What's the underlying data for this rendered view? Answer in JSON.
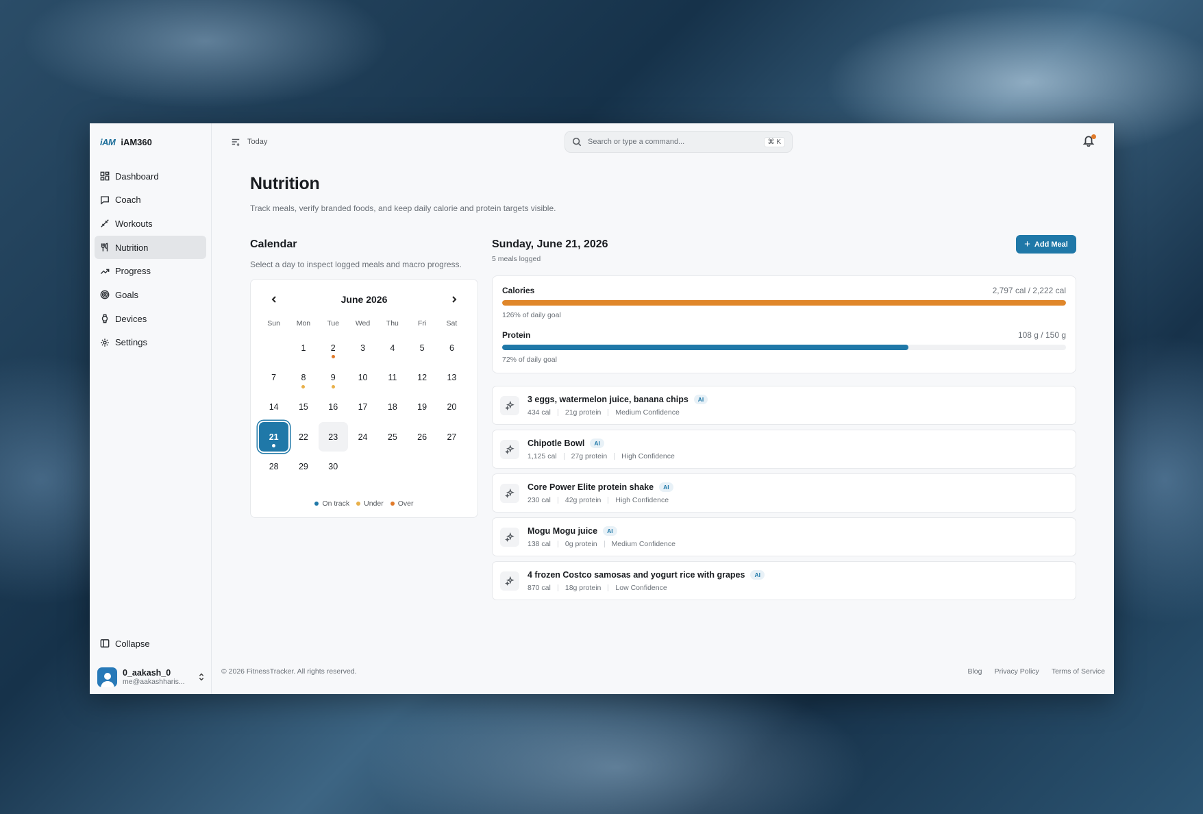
{
  "app": {
    "logo": "iAM",
    "name": "iAM360"
  },
  "sidebar": {
    "items": [
      {
        "label": "Dashboard",
        "icon": "dashboard-icon"
      },
      {
        "label": "Coach",
        "icon": "chat-icon"
      },
      {
        "label": "Workouts",
        "icon": "workouts-icon"
      },
      {
        "label": "Nutrition",
        "icon": "utensils-icon",
        "active": true
      },
      {
        "label": "Progress",
        "icon": "trending-up-icon"
      },
      {
        "label": "Goals",
        "icon": "target-icon"
      },
      {
        "label": "Devices",
        "icon": "watch-icon"
      },
      {
        "label": "Settings",
        "icon": "gear-icon"
      }
    ],
    "collapse_label": "Collapse",
    "user": {
      "name": "0_aakash_0",
      "email": "me@aakashharis..."
    }
  },
  "topbar": {
    "today_label": "Today",
    "search_placeholder": "Search or type a command...",
    "search_shortcut": "⌘ K"
  },
  "page": {
    "title": "Nutrition",
    "subtitle": "Track meals, verify branded foods, and keep daily calorie and protein targets visible."
  },
  "calendar": {
    "title": "Calendar",
    "subtitle": "Select a day to inspect logged meals and macro progress.",
    "month": "June 2026",
    "weekdays": [
      "Sun",
      "Mon",
      "Tue",
      "Wed",
      "Thu",
      "Fri",
      "Sat"
    ],
    "first_weekday_offset": 1,
    "days_in_month": 30,
    "selected_day": 21,
    "hover_day": 23,
    "day_status": {
      "2": "over",
      "8": "under",
      "9": "under",
      "21": "on-track"
    },
    "legend": [
      {
        "label": "On track",
        "status": "on-track"
      },
      {
        "label": "Under",
        "status": "under"
      },
      {
        "label": "Over",
        "status": "over"
      }
    ],
    "colors": {
      "on-track": "#1f78a8",
      "under": "#e8b04a",
      "over": "#e07a2a"
    }
  },
  "day": {
    "title": "Sunday, June 21, 2026",
    "meals_logged": "5 meals logged",
    "add_meal_label": "Add Meal"
  },
  "goals": {
    "calories": {
      "label": "Calories",
      "value": "2,797 cal / 2,222 cal",
      "percent_text": "126% of daily goal",
      "fill_fraction": 1.0,
      "color": "#e0872a"
    },
    "protein": {
      "label": "Protein",
      "value": "108 g / 150 g",
      "percent_text": "72% of daily goal",
      "fill_fraction": 0.72,
      "color": "#1f78a8"
    }
  },
  "meals": [
    {
      "name": "3 eggs, watermelon juice, banana chips",
      "badge": "AI",
      "calories": "434 cal",
      "protein": "21g protein",
      "confidence": "Medium Confidence"
    },
    {
      "name": "Chipotle Bowl",
      "badge": "AI",
      "calories": "1,125 cal",
      "protein": "27g protein",
      "confidence": "High Confidence"
    },
    {
      "name": "Core Power Elite protein shake",
      "badge": "AI",
      "calories": "230 cal",
      "protein": "42g protein",
      "confidence": "High Confidence"
    },
    {
      "name": "Mogu Mogu juice",
      "badge": "AI",
      "calories": "138 cal",
      "protein": "0g protein",
      "confidence": "Medium Confidence"
    },
    {
      "name": "4 frozen Costco samosas and yogurt rice with grapes",
      "badge": "AI",
      "calories": "870 cal",
      "protein": "18g protein",
      "confidence": "Low Confidence"
    }
  ],
  "footer": {
    "copyright": "© 2026 FitnessTracker. All rights reserved.",
    "links": [
      "Blog",
      "Privacy Policy",
      "Terms of Service"
    ]
  }
}
